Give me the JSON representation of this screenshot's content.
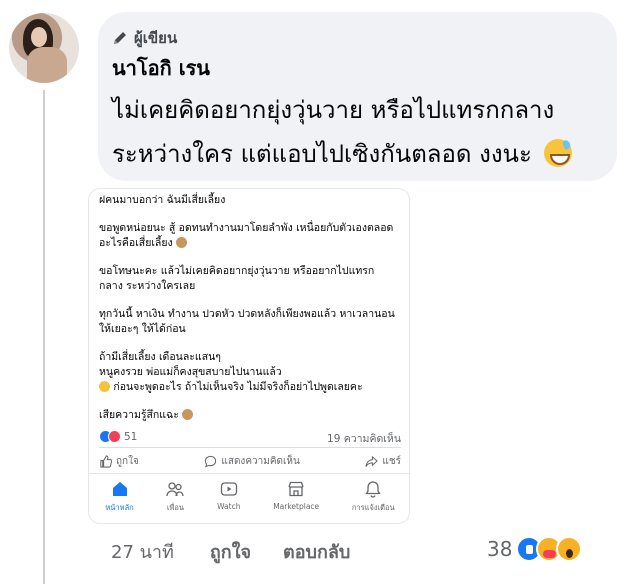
{
  "comment": {
    "badge": "ผู้เขียน",
    "author": "นาโอกิ เรน",
    "text": "ไม่เคยคิดอยากยุ่งวุ่นวาย หรือไปแทรกกลาง ระหว่างใคร แต่แอบไปเซิงกันตลอด งงนะ",
    "emoji_icon": "grinning-sweat-emoji"
  },
  "shared_post": {
    "lines": [
      "ฝคนมาบอกว่า ฉันมีเสี่ยเลี้ยง",
      "ขอพูดหน่อยนะ สู้ อดทนทำงานมาโดยลำพัง เหนื่อยกับตัวเองตลอด อะไรคือเสี่ยเลี้ยง",
      "ขอโทษนะคะ แล้วไม่เคยคิดอยากยุ่งวุ่นวาย หรืออยากไปแทรก กลาง ระหว่างใครเลย",
      "ทุกวันนี้ หาเงิน ทำงาน ปวดหัว ปวดหลังก็เพียงพอแล้ว หาเวลานอน ให้เยอะๆ ให้ได้ก่อน",
      "ถ้ามีเสี่ยเลี้ยง เดือนละแสนๆ",
      "หนูคงรวย พ่อแม่ก็คงสุขสบายไปนานแล้ว",
      "ก่อนจะพูดอะไร ถ้าไม่เห็นจริง ไม่มีจริงก็อย่าไปพูดเลยคะ",
      "เสียความรู้สึกแฉะ"
    ],
    "reaction_count": "51",
    "comment_count": "19 ความคิดเห็น",
    "actions": {
      "like": "ถูกใจ",
      "comment": "แสดงความคิดเห็น",
      "share": "แชร์"
    },
    "tabs": [
      "หน้าหลัก",
      "เพื่อน",
      "Watch",
      "Marketplace",
      "การแจ้งเตือน"
    ]
  },
  "meta": {
    "time": "27 นาที",
    "like": "ถูกใจ",
    "reply": "ตอบกลับ",
    "reaction_count": "38"
  },
  "colors": {
    "accent": "#1877f2",
    "bubble_bg": "#f0f2f5",
    "secondary_text": "#65676b"
  }
}
